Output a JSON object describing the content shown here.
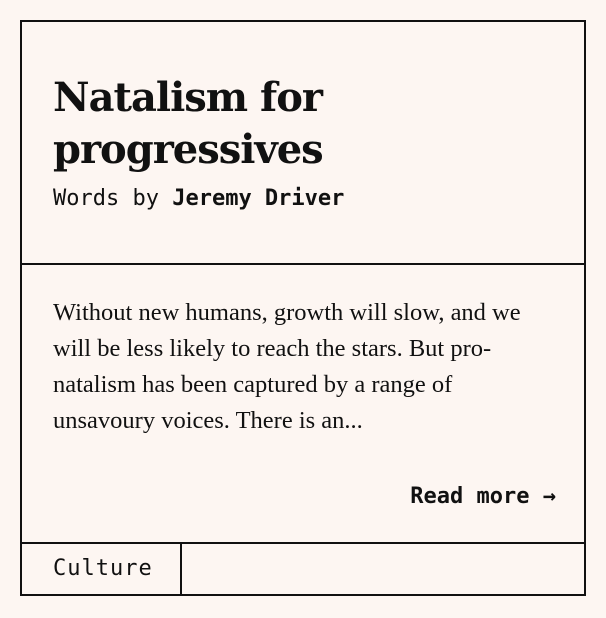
{
  "article": {
    "title": "Natalism for progressives",
    "byline_prefix": "Words by",
    "author": "Jeremy Driver",
    "excerpt": "Without new humans, growth will slow, and we will be less likely to reach the stars. But pro-natalism has been captured by a range of unsavoury voices. There is an...",
    "read_more_label": "Read more",
    "read_more_arrow": "→",
    "category": "Culture"
  },
  "colors": {
    "background": "#fdf6f2",
    "ink": "#111111"
  }
}
